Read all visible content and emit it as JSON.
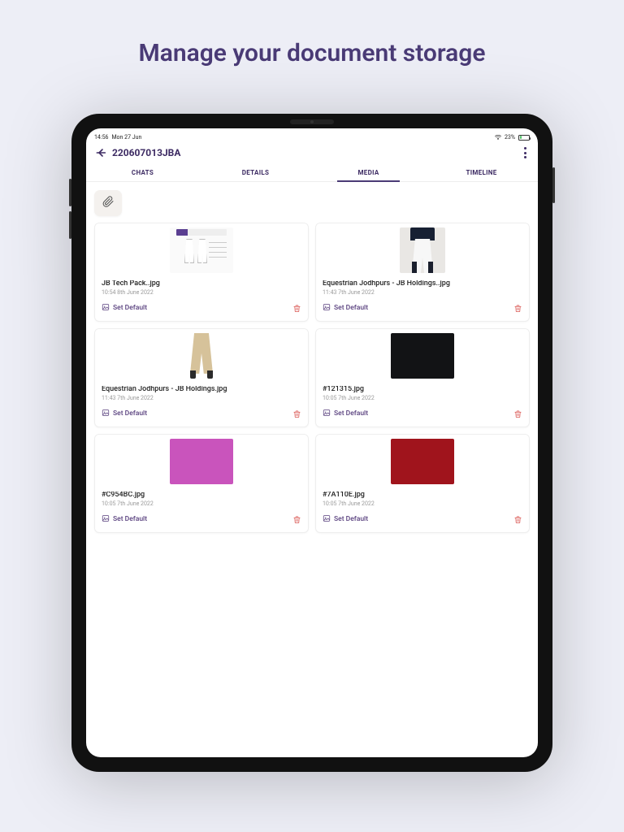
{
  "hero": {
    "title": "Manage your document storage"
  },
  "status": {
    "time": "14:56",
    "date": "Mon 27 Jun",
    "battery_text": "23%"
  },
  "header": {
    "title": "220607013JBA"
  },
  "tabs": [
    {
      "label": "CHATS",
      "active": false
    },
    {
      "label": "DETAILS",
      "active": false
    },
    {
      "label": "MEDIA",
      "active": true
    },
    {
      "label": "TIMELINE",
      "active": false
    }
  ],
  "set_default_label": "Set Default",
  "media": [
    {
      "name": "JB Tech Pack..jpg",
      "meta": "10:54 8th June 2022",
      "thumb": "techpack"
    },
    {
      "name": "Equestrian Jodhpurs - JB Holdings..jpg",
      "meta": "11:43 7th June 2022",
      "thumb": "jodhpur_white"
    },
    {
      "name": "Equestrian Jodhpurs - JB Holdings.jpg",
      "meta": "11:43 7th June 2022",
      "thumb": "jodhpur_tan"
    },
    {
      "name": "#121315.jpg",
      "meta": "10:05 7th June 2022",
      "thumb": "swatch",
      "swatch": "#121315"
    },
    {
      "name": "#C954BC.jpg",
      "meta": "10:05 7th June 2022",
      "thumb": "swatch",
      "swatch": "#C954BC"
    },
    {
      "name": "#7A110E.jpg",
      "meta": "10:05 7th June 2022",
      "thumb": "swatch",
      "swatch": "#a0141c"
    }
  ]
}
